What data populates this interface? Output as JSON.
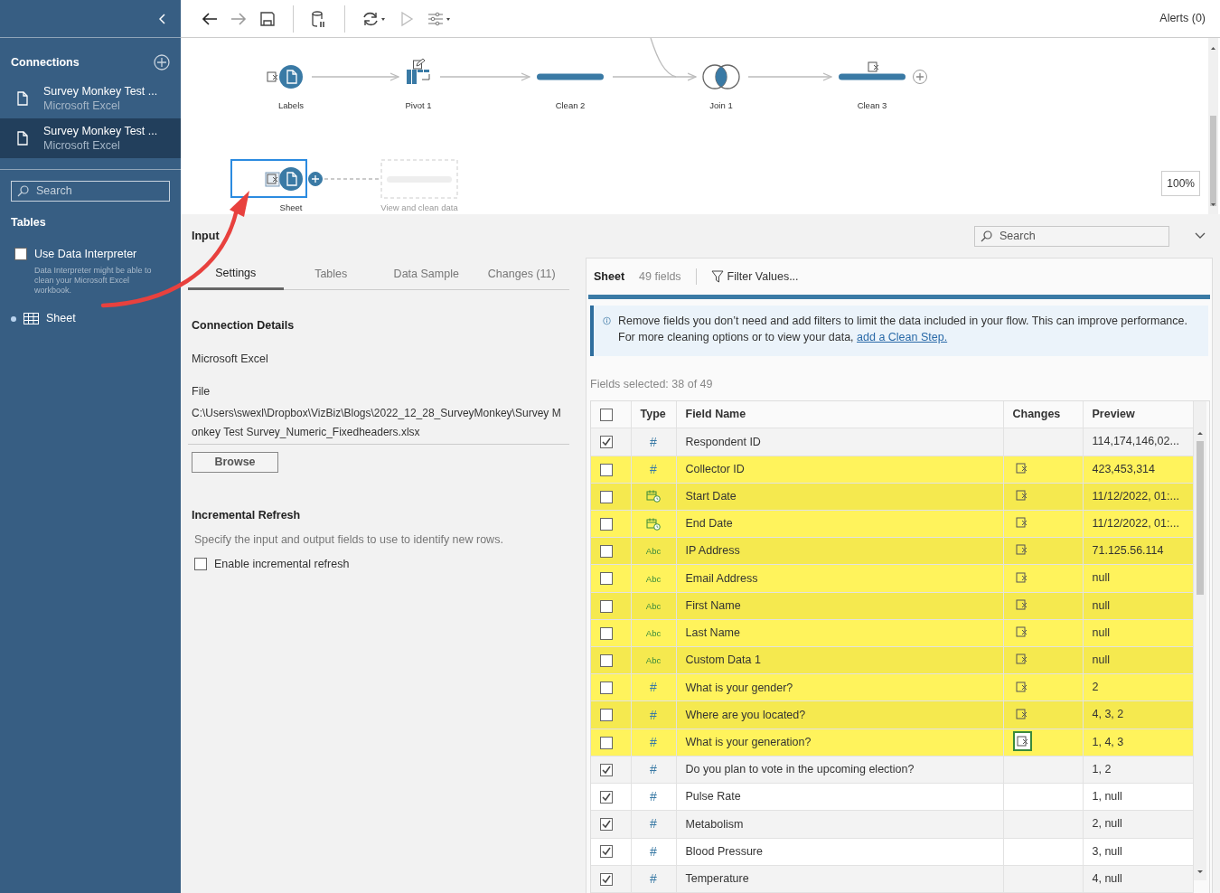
{
  "sidebar": {
    "connections_title": "Connections",
    "connections": [
      {
        "name": "Survey Monkey Test ...",
        "type": "Microsoft Excel",
        "selected": false
      },
      {
        "name": "Survey Monkey Test ...",
        "type": "Microsoft Excel",
        "selected": true
      }
    ],
    "search_placeholder": "Search",
    "tables_title": "Tables",
    "data_interpreter": {
      "label": "Use Data Interpreter",
      "checked": false,
      "description": "Data Interpreter might be able to clean your Microsoft Excel workbook."
    },
    "tables": [
      {
        "name": "Sheet",
        "selected": true
      }
    ]
  },
  "toolbar": {
    "alerts": "Alerts (0)"
  },
  "flow": {
    "rows": [
      [
        {
          "kind": "input",
          "label": "Labels",
          "removed_fields": true,
          "edited": false,
          "selected": false,
          "add_button": false
        },
        {
          "kind": "pivot",
          "label": "Pivot 1",
          "removed_fields": false,
          "edited": true,
          "selected": false,
          "add_button": false
        },
        {
          "kind": "clean",
          "label": "Clean 2",
          "removed_fields": false,
          "edited": false,
          "selected": false,
          "add_button": false
        },
        {
          "kind": "join",
          "label": "Join 1",
          "removed_fields": false,
          "edited": false,
          "selected": false,
          "add_button": false
        },
        {
          "kind": "clean",
          "label": "Clean 3",
          "removed_fields": true,
          "edited": false,
          "selected": false,
          "add_button": true
        }
      ],
      [
        {
          "kind": "input",
          "label": "Sheet",
          "removed_fields": true,
          "edited": false,
          "selected": true,
          "add_button": true
        },
        {
          "kind": "placeholder",
          "label": "View and clean data",
          "removed_fields": false,
          "edited": false,
          "selected": false,
          "add_button": false
        }
      ]
    ],
    "zoom": "100%"
  },
  "input_panel": {
    "title": "Input",
    "search_placeholder": "Search",
    "tabs": [
      {
        "label": "Settings",
        "selected": true
      },
      {
        "label": "Tables",
        "selected": false
      },
      {
        "label": "Data Sample",
        "selected": false
      },
      {
        "label": "Changes (11)",
        "selected": false
      }
    ],
    "connection_details_title": "Connection Details",
    "connection_type": "Microsoft Excel",
    "file_label": "File",
    "file_path": "C:\\Users\\swexl\\Dropbox\\VizBiz\\Blogs\\2022_12_28_SurveyMonkey\\Survey Monkey Test Survey_Numeric_Fixedheaders.xlsx",
    "browse_button": "Browse",
    "incremental_title": "Incremental Refresh",
    "incremental_description": "Specify the input and output fields to use to identify new rows.",
    "incremental": {
      "label": "Enable incremental refresh",
      "checked": false
    }
  },
  "fields_panel": {
    "sheet": "Sheet",
    "field_count": "49 fields",
    "filter_button": "Filter Values...",
    "info_text": "Remove fields you don’t need and add filters to limit the data included in your flow. This can improve performance. For more cleaning options or to view your data, ",
    "info_link": "add a Clean Step.",
    "fields_selected": "Fields selected: 38 of 49",
    "select_all_checked": false,
    "columns": [
      "Type",
      "Field Name",
      "Changes",
      "Preview"
    ],
    "rows": [
      {
        "checked": true,
        "highlighted": false,
        "kind": "number",
        "type_label": "#",
        "name": "Respondent ID",
        "changed": false,
        "preview": "114,174,146,02..."
      },
      {
        "checked": false,
        "highlighted": true,
        "kind": "number",
        "type_label": "#",
        "name": "Collector ID",
        "changed": true,
        "change_selected": false,
        "preview": "423,453,314"
      },
      {
        "checked": false,
        "highlighted": true,
        "kind": "date",
        "name": "Start Date",
        "changed": true,
        "change_selected": false,
        "preview": "11/12/2022, 01:..."
      },
      {
        "checked": false,
        "highlighted": true,
        "kind": "date",
        "name": "End Date",
        "changed": true,
        "change_selected": false,
        "preview": "11/12/2022, 01:..."
      },
      {
        "checked": false,
        "highlighted": true,
        "kind": "string",
        "type_label": "Abc",
        "name": "IP Address",
        "changed": true,
        "change_selected": false,
        "preview": "71.125.56.114"
      },
      {
        "checked": false,
        "highlighted": true,
        "kind": "string",
        "type_label": "Abc",
        "name": "Email Address",
        "changed": true,
        "change_selected": false,
        "preview": "null"
      },
      {
        "checked": false,
        "highlighted": true,
        "kind": "string",
        "type_label": "Abc",
        "name": "First Name",
        "changed": true,
        "change_selected": false,
        "preview": "null"
      },
      {
        "checked": false,
        "highlighted": true,
        "kind": "string",
        "type_label": "Abc",
        "name": "Last Name",
        "changed": true,
        "change_selected": false,
        "preview": "null"
      },
      {
        "checked": false,
        "highlighted": true,
        "kind": "string",
        "type_label": "Abc",
        "name": "Custom Data 1",
        "changed": true,
        "change_selected": false,
        "preview": "null"
      },
      {
        "checked": false,
        "highlighted": true,
        "kind": "number",
        "type_label": "#",
        "name": "What is your gender?",
        "changed": true,
        "change_selected": false,
        "preview": "2"
      },
      {
        "checked": false,
        "highlighted": true,
        "kind": "number",
        "type_label": "#",
        "name": "Where are you located?",
        "changed": true,
        "change_selected": false,
        "preview": "4, 3, 2"
      },
      {
        "checked": false,
        "highlighted": true,
        "kind": "number",
        "type_label": "#",
        "name": "What is your generation?",
        "changed": true,
        "change_selected": true,
        "preview": "1, 4, 3"
      },
      {
        "checked": true,
        "highlighted": false,
        "kind": "number",
        "type_label": "#",
        "name": "Do you plan to vote in the upcoming election?",
        "changed": false,
        "preview": "1, 2"
      },
      {
        "checked": true,
        "highlighted": false,
        "kind": "number",
        "type_label": "#",
        "name": "Pulse Rate",
        "changed": false,
        "preview": "1, null"
      },
      {
        "checked": true,
        "highlighted": false,
        "kind": "number",
        "type_label": "#",
        "name": "Metabolism",
        "changed": false,
        "preview": "2, null"
      },
      {
        "checked": true,
        "highlighted": false,
        "kind": "number",
        "type_label": "#",
        "name": "Blood Pressure",
        "changed": false,
        "preview": "3, null"
      },
      {
        "checked": true,
        "highlighted": false,
        "kind": "number",
        "type_label": "#",
        "name": "Temperature",
        "changed": false,
        "preview": "4, null"
      }
    ]
  },
  "annotation": {
    "kind": "arrow",
    "color": "#e8413e"
  }
}
